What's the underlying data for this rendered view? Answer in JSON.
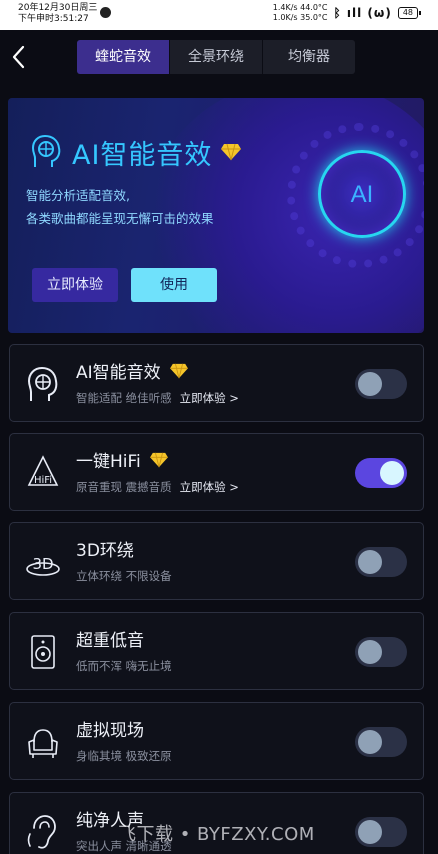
{
  "status_bar": {
    "date": "20年12月30日周三",
    "time": "下午申时3:51:27",
    "speed_up": "1.4K/s 44.0°C",
    "speed_down": "1.0K/s 35.0°C",
    "signal_text": "ᛒ ıll (ω)",
    "battery": "48"
  },
  "header": {
    "tabs": [
      {
        "label": "蝰蛇音效"
      },
      {
        "label": "全景环绕"
      },
      {
        "label": "均衡器"
      }
    ],
    "active_tab": 0
  },
  "banner": {
    "title": "AI智能音效",
    "subtitle_1": "智能分析适配音效,",
    "subtitle_2": "各类歌曲都能呈现无懈可击的效果",
    "orb_text": "AI",
    "try_label": "立即体验",
    "use_label": "使用"
  },
  "effects": [
    {
      "title": "AI智能音效",
      "desc": "智能适配 绝佳听感",
      "try": "立即体验 >",
      "premium": true,
      "enabled": false,
      "icon": "ai-head-icon"
    },
    {
      "title": "一键HiFi",
      "desc": "原音重现 震撼音质",
      "try": "立即体验 >",
      "premium": true,
      "enabled": true,
      "icon": "hifi-icon"
    },
    {
      "title": "3D环绕",
      "desc": "立体环绕 不限设备",
      "try": "",
      "premium": false,
      "enabled": false,
      "icon": "3d-surround-icon"
    },
    {
      "title": "超重低音",
      "desc": "低而不浑 嗨无止境",
      "try": "",
      "premium": false,
      "enabled": false,
      "icon": "speaker-icon"
    },
    {
      "title": "虚拟现场",
      "desc": "身临其境 极致还原",
      "try": "",
      "premium": false,
      "enabled": false,
      "icon": "armchair-icon"
    },
    {
      "title": "纯净人声",
      "desc": "突出人声 清晰通透",
      "try": "",
      "premium": false,
      "enabled": false,
      "icon": "ear-icon"
    }
  ],
  "watermark": "飞下载 • BYFZXY.COM",
  "colors": {
    "accent": "#5b46e0",
    "tab_active": "#3c2e8e",
    "banner_title": "#35c7ff",
    "gem": "#f5c52a"
  }
}
